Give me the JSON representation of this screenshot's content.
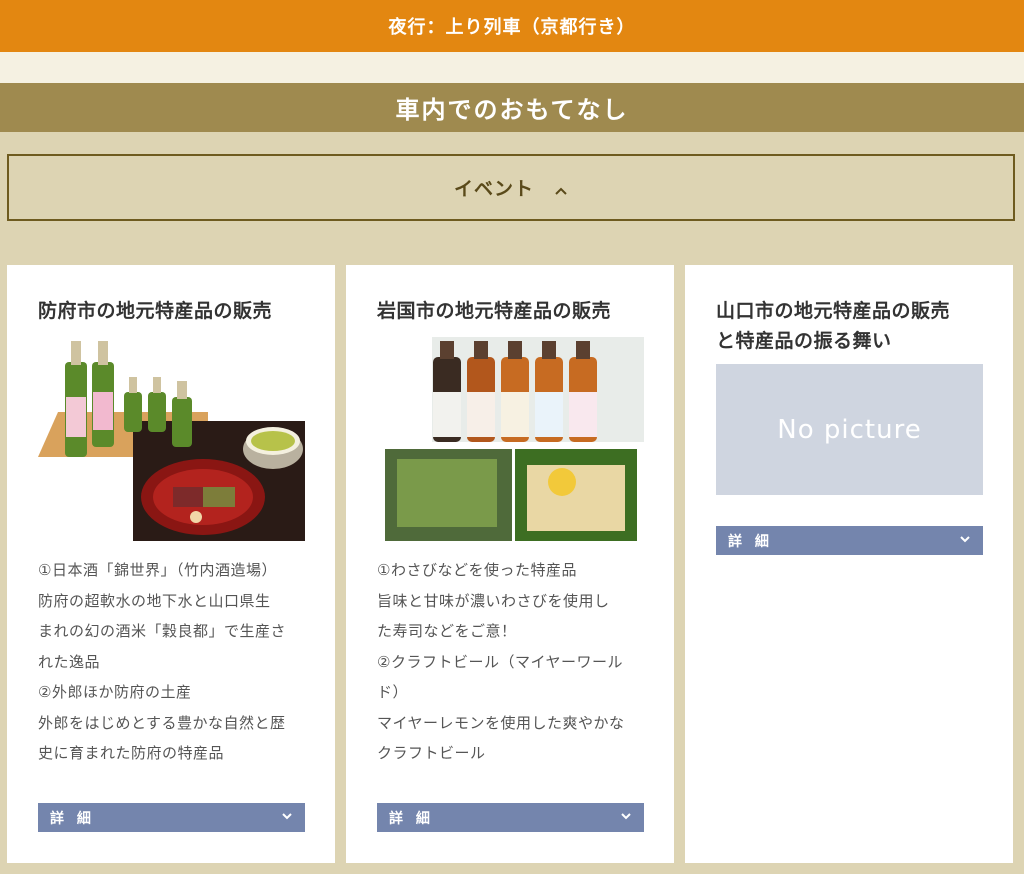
{
  "header": {
    "title": "夜行：上り列車（京都行き）"
  },
  "section": {
    "title": "車内でのおもてなし"
  },
  "accordion": {
    "label": "イベント"
  },
  "cards": [
    {
      "title": "防府市の地元特産品の販売",
      "lines": [
        "①日本酒「錦世界」（竹内酒造場）",
        "防府の超軟水の地下水と山口県生",
        "まれの幻の酒米「穀良都」で生産さ",
        "れた逸品",
        "②外郎ほか防府の土産",
        "外郎をはじめとする豊かな自然と歴",
        "史に育まれた防府の特産品"
      ],
      "button": "詳 細"
    },
    {
      "title": "岩国市の地元特産品の販売",
      "lines": [
        "①わさびなどを使った特産品",
        "旨味と甘味が濃いわさびを使用し",
        "た寿司などをご意！",
        "②クラフトビール（マイヤーワール",
        "ド）",
        "マイヤーレモンを使用した爽やかな",
        "クラフトビール"
      ],
      "button": "詳 細"
    },
    {
      "title_line1": "山口市の地元特産品の販売",
      "title_line2": "と特産品の振る舞い",
      "no_picture": "No picture",
      "button": "詳 細"
    }
  ],
  "colors": {
    "topbar": "#e38711",
    "section": "#9f8a4f",
    "background": "#ddd4b3",
    "button": "#7485ad"
  }
}
